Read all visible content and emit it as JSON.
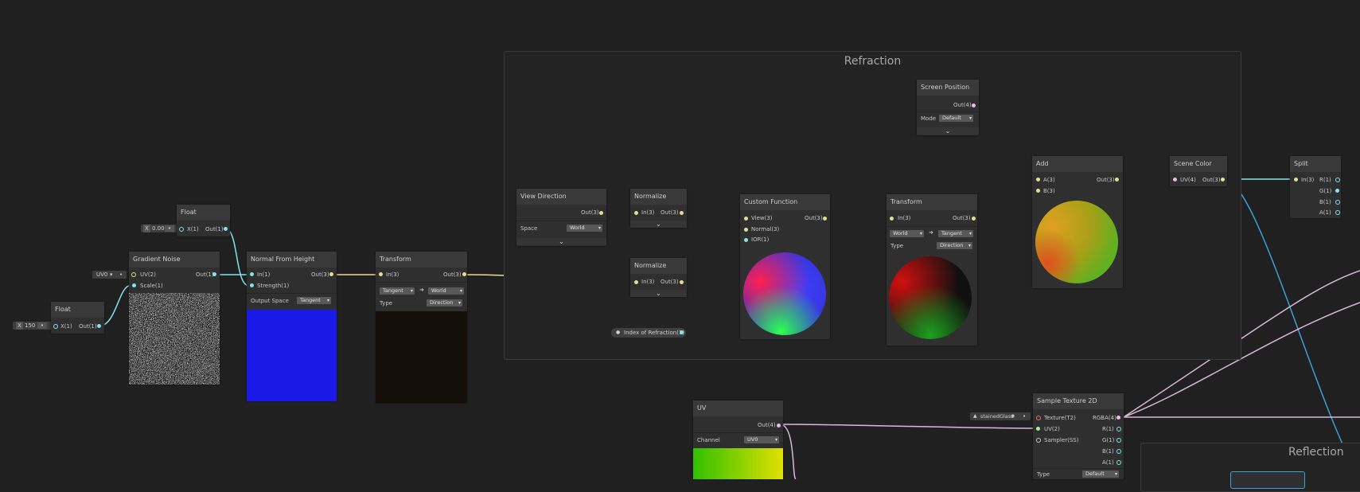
{
  "groups": {
    "refraction": "Refraction",
    "reflection": "Reflection"
  },
  "nodes": {
    "float1": {
      "title": "Float",
      "in": "X(1)",
      "out": "Out(1)",
      "x_label": "X",
      "x_value": "150"
    },
    "float2": {
      "title": "Float",
      "in": "X(1)",
      "out": "Out(1)",
      "x_label": "X",
      "x_value": "0.00"
    },
    "gradient_noise": {
      "title": "Gradient Noise",
      "in1": "UV(2)",
      "in2": "Scale(1)",
      "out": "Out(1)",
      "uv_value": "UV0"
    },
    "normal_from_height": {
      "title": "Normal From Height",
      "in1": "In(1)",
      "in2": "Strength(1)",
      "out": "Out(3)",
      "space_label": "Output Space",
      "space_value": "Tangent"
    },
    "transform1": {
      "title": "Transform",
      "in": "In(3)",
      "out": "Out(3)",
      "from": "Tangent",
      "to": "World",
      "type_label": "Type",
      "type_value": "Direction"
    },
    "view_direction": {
      "title": "View Direction",
      "out": "Out(3)",
      "space_label": "Space",
      "space_value": "World"
    },
    "normalize1": {
      "title": "Normalize",
      "in": "In(3)",
      "out": "Out(3)"
    },
    "normalize2": {
      "title": "Normalize",
      "in": "In(3)",
      "out": "Out(3)"
    },
    "ior": {
      "label": "Index of Refraction(1)"
    },
    "custom_function": {
      "title": "Custom Function",
      "in1": "View(3)",
      "in2": "Normal(3)",
      "in3": "IOR(1)",
      "out": "Out(3)"
    },
    "transform2": {
      "title": "Transform",
      "in": "In(3)",
      "out": "Out(3)",
      "from": "World",
      "to": "Tangent",
      "type_label": "Type",
      "type_value": "Direction"
    },
    "screen_position": {
      "title": "Screen Position",
      "out": "Out(4)",
      "mode_label": "Mode",
      "mode_value": "Default"
    },
    "add": {
      "title": "Add",
      "in1": "A(3)",
      "in2": "B(3)",
      "out": "Out(3)"
    },
    "scene_color": {
      "title": "Scene Color",
      "in": "UV(4)",
      "out": "Out(3)"
    },
    "split": {
      "title": "Split",
      "in": "In(3)",
      "out1": "R(1)",
      "out2": "G(1)",
      "out3": "B(1)",
      "out4": "A(1)"
    },
    "uv": {
      "title": "UV",
      "out": "Out(4)",
      "channel_label": "Channel",
      "channel_value": "UV0"
    },
    "sample_texture": {
      "title": "Sample Texture 2D",
      "in1": "Texture(T2)",
      "in2": "UV(2)",
      "in3": "Sampler(SS)",
      "out1": "RGBA(4)",
      "out2": "R(1)",
      "out3": "G(1)",
      "out4": "B(1)",
      "out5": "A(1)",
      "type_label": "Type",
      "type_value": "Default",
      "texture_value": "stainedGlass"
    }
  },
  "colors": {
    "vec3": "#e0e090",
    "vec1": "#84e4e7",
    "vec4": "#f0b8e8"
  }
}
